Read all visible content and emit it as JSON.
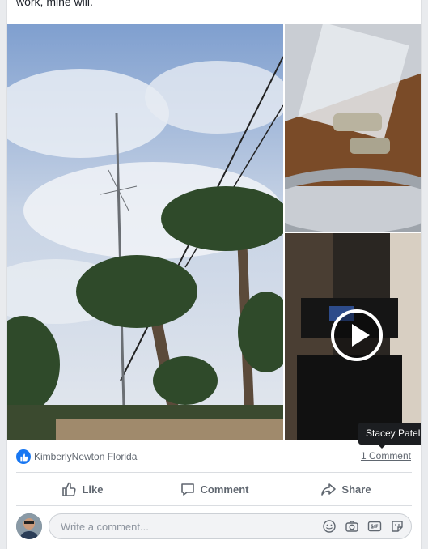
{
  "post": {
    "text": "work, mine will."
  },
  "media": [
    {
      "kind": "photo",
      "subject": "antenna and palm trees"
    },
    {
      "kind": "photo",
      "subject": "coax connectors in bag"
    },
    {
      "kind": "video",
      "subject": "radio equipment"
    }
  ],
  "tooltip": {
    "text": "Stacey Patel"
  },
  "reactions": {
    "icon": "like-icon",
    "names": "KimberlyNewton Florida",
    "comments": "1 Comment"
  },
  "actions": [
    {
      "label": "Like",
      "icon": "thumbs-up-icon"
    },
    {
      "label": "Comment",
      "icon": "comment-icon"
    },
    {
      "label": "Share",
      "icon": "share-icon"
    }
  ],
  "composer": {
    "placeholder": "Write a comment...",
    "icons": [
      "emoji-icon",
      "camera-icon",
      "gif-icon",
      "sticker-icon"
    ]
  },
  "colors": {
    "accent": "#1877f2",
    "text": "#606770",
    "tooltip_bg": "#1c1e21"
  }
}
